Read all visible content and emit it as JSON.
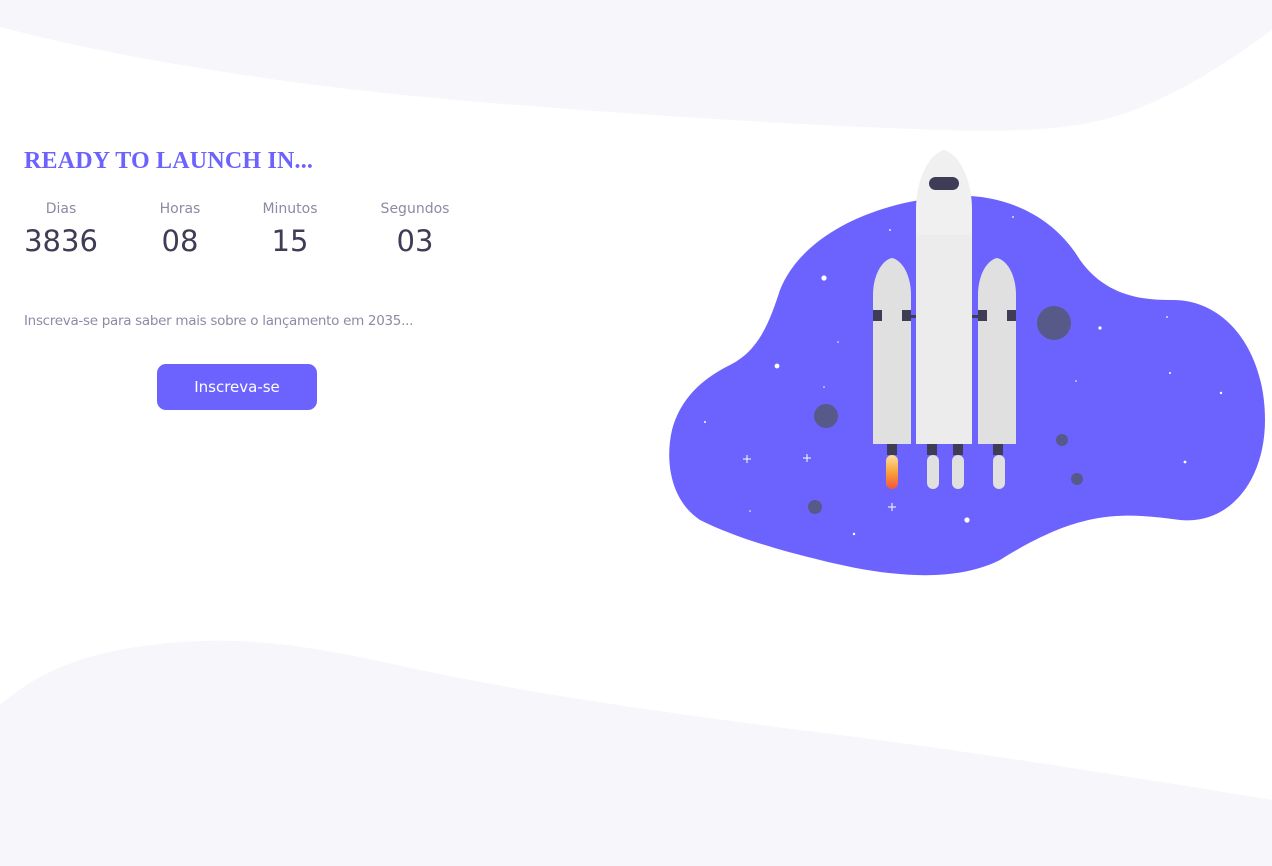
{
  "hero": {
    "headline": "READY TO LAUNCH IN..."
  },
  "countdown": {
    "units": [
      {
        "label": "Dias",
        "value": "3836"
      },
      {
        "label": "Horas",
        "value": "08"
      },
      {
        "label": "Minutos",
        "value": "15"
      },
      {
        "label": "Segundos",
        "value": "03"
      }
    ]
  },
  "subscribe": {
    "text": "Inscreva-se para saber mais sobre o lançamento em 2035...",
    "button_label": "Inscreva-se"
  },
  "colors": {
    "accent": "#6c63ff",
    "wave": "#f6f6fb",
    "text_dark": "#3f3d56",
    "text_muted": "#8f8aa3",
    "rocket_body": "#f0f0f0",
    "booster": "#e0e0e0",
    "detail": "#3f3d56",
    "planet": "#575a89"
  },
  "illustration": {
    "icon": "rocket-launch-icon"
  }
}
